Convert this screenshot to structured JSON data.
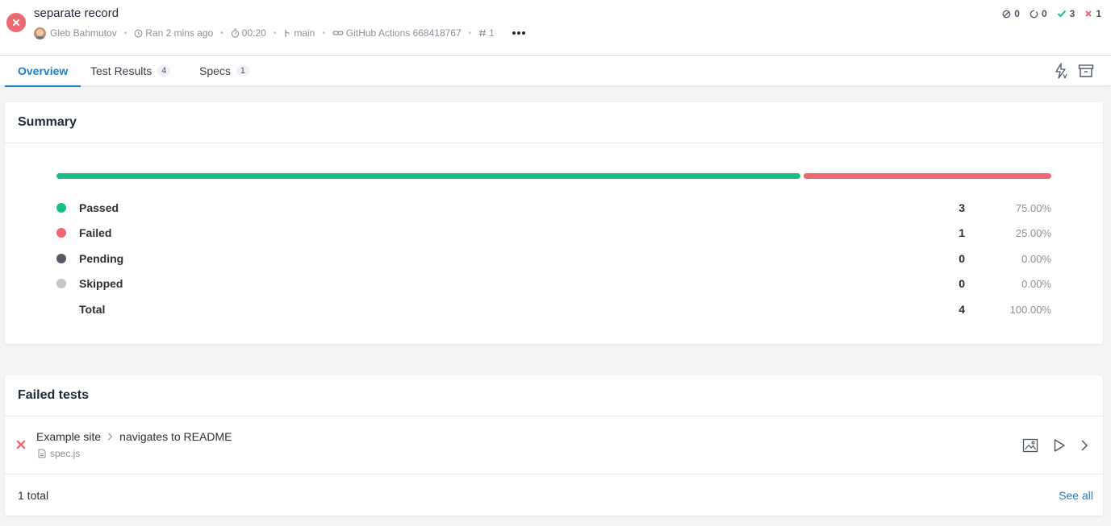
{
  "header": {
    "title": "separate record",
    "author": "Gleb Bahmutov",
    "ran": "Ran 2 mins ago",
    "duration": "00:20",
    "branch": "main",
    "ci": "GitHub Actions 668418767",
    "run_number": "1",
    "counts": {
      "skipped": "0",
      "pending": "0",
      "passed": "3",
      "failed": "1"
    }
  },
  "tabs": [
    {
      "label": "Overview",
      "badge": ""
    },
    {
      "label": "Test Results",
      "badge": "4"
    },
    {
      "label": "Specs",
      "badge": "1"
    }
  ],
  "summary": {
    "title": "Summary",
    "progress": {
      "passed_fraction": 0.75,
      "failed_fraction": 0.25
    },
    "rows": [
      {
        "label": "Passed",
        "count": "3",
        "percent": "75.00%",
        "color": "#16bf88"
      },
      {
        "label": "Failed",
        "count": "1",
        "percent": "25.00%",
        "color": "#f0686f"
      },
      {
        "label": "Pending",
        "count": "0",
        "percent": "0.00%",
        "color": "#535a66"
      },
      {
        "label": "Skipped",
        "count": "0",
        "percent": "0.00%",
        "color": "#c2c4c8"
      },
      {
        "label": "Total",
        "count": "4",
        "percent": "100.00%",
        "color": ""
      }
    ]
  },
  "failed_tests": {
    "title": "Failed tests",
    "items": [
      {
        "suite": "Example site",
        "test": "navigates to README",
        "spec": "spec.js"
      }
    ],
    "total_label": "1 total",
    "see_all": "See all"
  },
  "colors": {
    "accent": "#1d7fc4",
    "passed": "#16bf88",
    "failed": "#f0686f",
    "status_failed": "#ec6b73"
  },
  "icons": {
    "status": "x-circle-icon",
    "flaky": "lightning-icon",
    "archive": "archive-icon",
    "screenshot": "image-icon",
    "video": "play-icon",
    "open": "chevron-right-icon"
  }
}
